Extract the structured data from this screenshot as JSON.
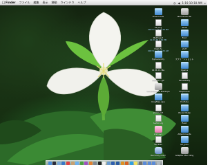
{
  "menubar": {
    "apple": "",
    "menus": [
      "Finder",
      "ファイル",
      "編集",
      "表示",
      "移動",
      "ウインドウ",
      "ヘルプ"
    ],
    "clock": "1:19 10:10 AM"
  },
  "desktop_icons": [
    {
      "label": "Macintosh HD",
      "sub": "",
      "kind": "disk"
    },
    {
      "label": "Downloads",
      "sub": "",
      "kind": "folder"
    },
    {
      "label": "Stuff",
      "sub": "",
      "kind": "folder"
    },
    {
      "label": "01.png",
      "sub": "2007.11.17 01:39 PM",
      "kind": "doc"
    },
    {
      "label": "Font",
      "sub": "",
      "kind": "folder"
    },
    {
      "label": "MyProject",
      "sub": "11.37.48 2:52 PM",
      "kind": "doc"
    },
    {
      "label": "stuff",
      "sub": "",
      "kind": "folder"
    },
    {
      "label": "DigiLife",
      "sub": "2007.11.17 01:25 AM",
      "kind": "doc"
    },
    {
      "label": "スクリーンショット",
      "sub": "",
      "kind": "folder"
    },
    {
      "label": "TyphoonCity",
      "sub": "",
      "kind": "folder"
    },
    {
      "label": "ifgame",
      "sub": "",
      "kind": "folder"
    },
    {
      "label": "01 M.-D.-file",
      "sub": "",
      "kind": "doc"
    },
    {
      "label": "Saveability",
      "sub": "",
      "kind": "doc"
    },
    {
      "label": "00000 1.gif",
      "sub": "",
      "kind": "pdf"
    },
    {
      "label": "Stephanie",
      "sub": "",
      "kind": "pdf"
    },
    {
      "label": "TimeMachine Backups",
      "sub": "",
      "kind": "disk"
    },
    {
      "label": "YouTube",
      "sub": "",
      "kind": "folder"
    },
    {
      "label": "blogfiles.app",
      "sub": "",
      "kind": "folder"
    },
    {
      "label": "Movie Maker",
      "sub": "",
      "kind": "folder"
    },
    {
      "label": "photo.pdf",
      "sub": "",
      "kind": "pdf"
    },
    {
      "label": "flash",
      "sub": "",
      "kind": "folder"
    },
    {
      "label": "Audio Log",
      "sub": "",
      "kind": "doc"
    },
    {
      "label": "Attachments",
      "sub": "",
      "kind": "folder"
    },
    {
      "label": "stickeys",
      "sub": "",
      "kind": "pink"
    },
    {
      "label": "art_pics",
      "sub": "",
      "kind": "folder"
    },
    {
      "label": "Stickies",
      "sub": "",
      "kind": "doc"
    },
    {
      "label": "Adapter Mac.dmg",
      "sub": "",
      "kind": "disk"
    },
    {
      "label": "Recently used",
      "sub": "",
      "kind": "app"
    }
  ],
  "dock": {
    "items": [
      "finder",
      "dashboard",
      "mail",
      "safari",
      "ical",
      "addressbook",
      "itunes",
      "iphoto",
      "imovie",
      "garageband",
      "preferences",
      "terminal",
      "textedit",
      "preview",
      "quicktime",
      "photoshop",
      "illustrator",
      "firefox",
      "skype",
      "stickies",
      "calculator",
      "applications",
      "documents",
      "downloads",
      "trash"
    ],
    "colors": [
      "#4a8ad8",
      "#2b2b3b",
      "#7aa8d8",
      "#3a78c8",
      "#e04040",
      "#c8a070",
      "#6bb0f0",
      "#4aa040",
      "#a050c0",
      "#e08030",
      "#808890",
      "#202020",
      "#f0f0f0",
      "#6a9ad0",
      "#3060b0",
      "#2a5aa0",
      "#e09020",
      "#d86020",
      "#30a0e0",
      "#f0e060",
      "#707070",
      "#5a8ad8",
      "#5a8ad8",
      "#5a8ad8",
      "#b0b8c0"
    ]
  }
}
